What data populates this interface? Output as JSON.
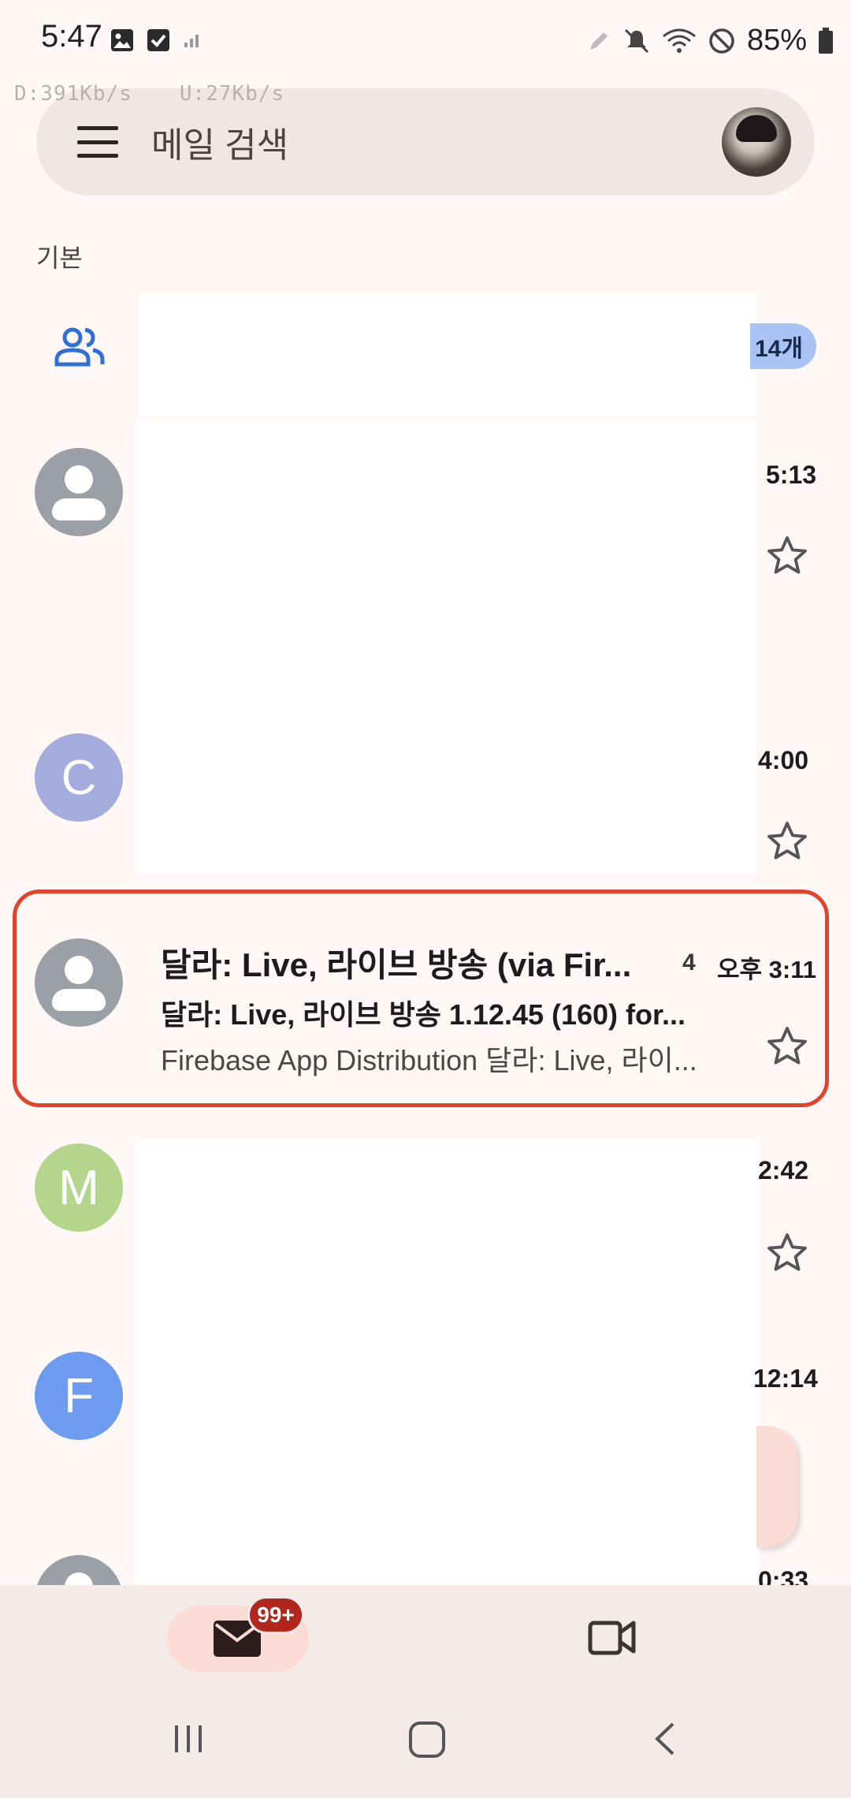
{
  "status_bar": {
    "time": "5:47",
    "battery": "85%",
    "download_speed": "D:391Kb/s",
    "upload_speed": "U:27Kb/s"
  },
  "search": {
    "placeholder": "메일 검색"
  },
  "section": {
    "label": "기본"
  },
  "list": {
    "social_count": "14개",
    "rows": [
      {
        "time": "5:13",
        "avatar_letter": ""
      },
      {
        "time": "4:00",
        "avatar_letter": "C",
        "avatar_color": "#a3acdc"
      },
      {
        "sender": "달라: Live, 라이브 방송 (via Fir...",
        "count": "4",
        "time": "오후 3:11",
        "subject": "달라: Live, 라이브 방송 1.12.45 (160) for...",
        "snippet": "Firebase App Distribution 달라: Live, 라이..."
      },
      {
        "time": "2:42",
        "avatar_letter": "M",
        "avatar_color": "#b4d68c"
      },
      {
        "time": "12:14",
        "avatar_letter": "F",
        "avatar_color": "#6c9bef"
      },
      {
        "time": "0:33",
        "avatar_letter": ""
      }
    ]
  },
  "bottom_nav": {
    "mail_badge": "99+"
  },
  "colors": {
    "highlight_border": "#e2432a",
    "badge_red": "#b3261e",
    "social_icon": "#2f6fd6"
  }
}
